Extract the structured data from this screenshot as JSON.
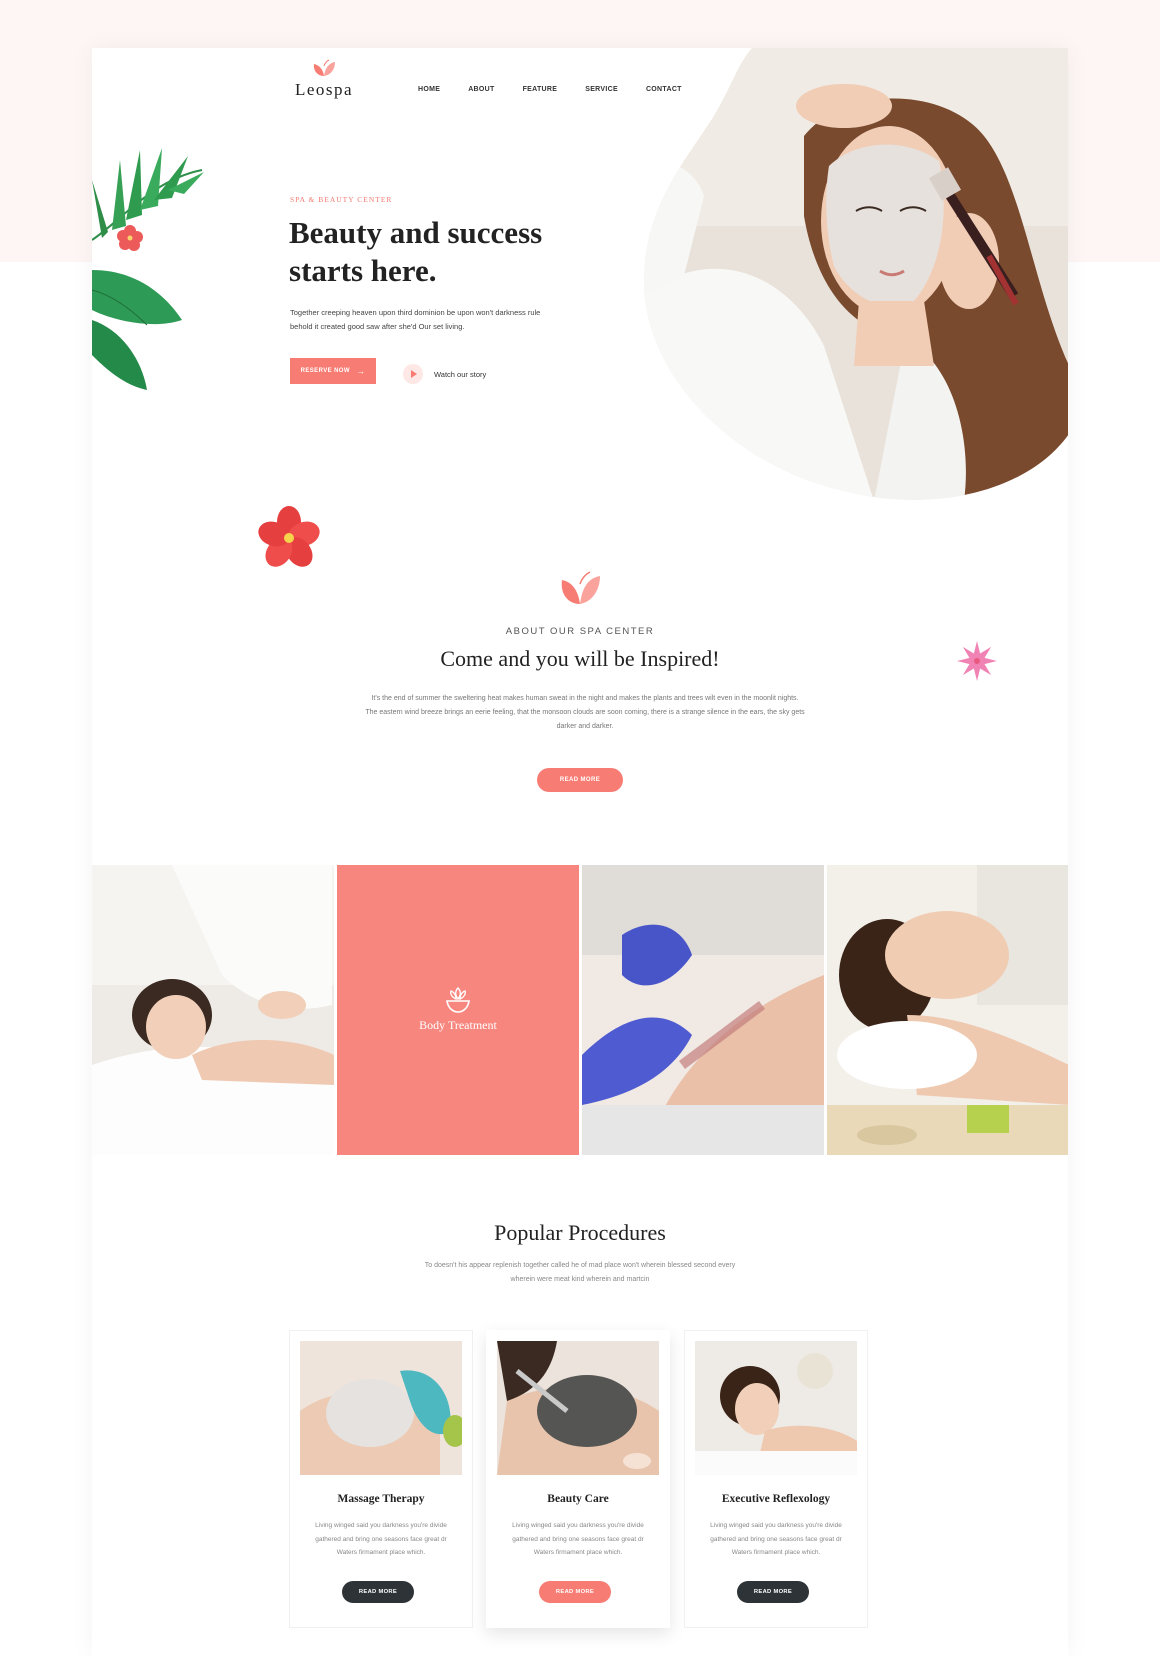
{
  "brand": {
    "name": "Leospa",
    "accent": "#f77c73",
    "dark": "#2d3336"
  },
  "nav": {
    "items": [
      "HOME",
      "ABOUT",
      "FEATURE",
      "SERVICE",
      "CONTACT"
    ]
  },
  "hero": {
    "tag": "SPA & BEAUTY CENTER",
    "title": "Beauty and success starts here.",
    "description": "Together creeping heaven upon third dominion be upon won't darkness rule behold it created good saw after she'd Our set living.",
    "cta_label": "RESERVE NOW",
    "watch_label": "Watch our story"
  },
  "about": {
    "tag": "ABOUT OUR SPA CENTER",
    "title": "Come and you will be Inspired!",
    "text": "It's the end of summer the sweltering heat makes human sweat in the night and makes the plants and trees wilt even in the moonlit nights. The eastern wind breeze brings an eerie feeling, that the monsoon clouds are soon coming, there is a strange silence in the ears, the sky gets darker and darker.",
    "button_label": "READ MORE"
  },
  "gallery": {
    "featured_label": "Body Treatment"
  },
  "procedures": {
    "title": "Popular Procedures",
    "description": "To doesn't his appear replenish together called he of mad place won't wherein blessed second every wherein were meat kind wherein and martcin",
    "cards": [
      {
        "title": "Massage Therapy",
        "description": "Living winged said you darkness you're divide gathered and bring one seasons face great dr Waters firmament place which.",
        "button": "READ MORE"
      },
      {
        "title": "Beauty Care",
        "description": "Living winged said you darkness you're divide gathered and bring one seasons face great dr Waters firmament place which.",
        "button": "READ MORE"
      },
      {
        "title": "Executive Reflexology",
        "description": "Living winged said you darkness you're divide gathered and bring one seasons face great dr Waters firmament place which.",
        "button": "READ MORE"
      }
    ]
  },
  "icons": [
    "butterfly-icon",
    "arrow-right-icon",
    "play-icon",
    "lotus-bowl-icon"
  ]
}
